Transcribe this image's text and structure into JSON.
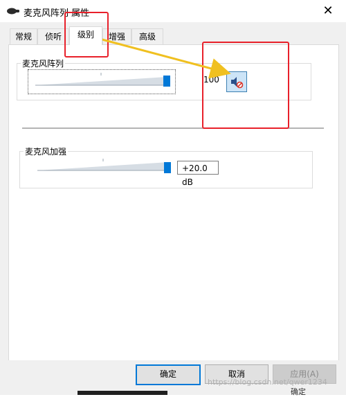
{
  "window": {
    "title": "麦克风阵列 属性",
    "close_symbol": "✕"
  },
  "tabs": [
    {
      "label": "常规",
      "active": false
    },
    {
      "label": "侦听",
      "active": false
    },
    {
      "label": "级别",
      "active": true
    },
    {
      "label": "增强",
      "active": false
    },
    {
      "label": "高级",
      "active": false
    }
  ],
  "level_group": {
    "label": "麦克风阵列",
    "value": "100",
    "slider_level": 1.0,
    "mute_icon": "speaker-muted-icon"
  },
  "boost_group": {
    "label": "麦克风加强",
    "value": "+20.0 dB",
    "slider_level": 1.0
  },
  "buttons": {
    "ok": "确定",
    "cancel": "取消",
    "apply": "应用(A)"
  },
  "background": {
    "watermark": "https://blog.csdn.net/qwer1234",
    "behind_button": "确定"
  },
  "colors": {
    "accent": "#0078d7",
    "annotation_red": "#e8202a",
    "annotation_arrow": "#f0c020"
  }
}
